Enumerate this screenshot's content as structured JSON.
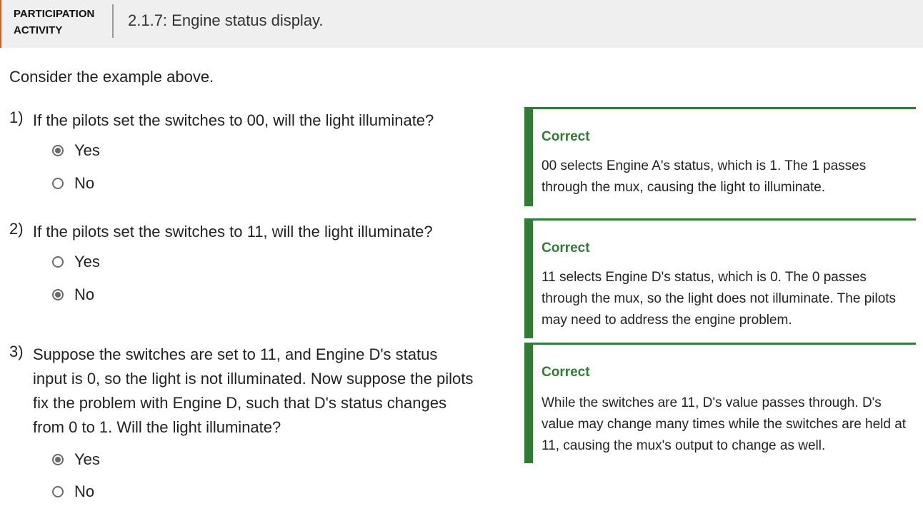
{
  "header": {
    "activity_label": "PARTICIPATION\nACTIVITY",
    "title": "2.1.7: Engine status display."
  },
  "intro": "Consider the example above.",
  "questions": [
    {
      "number": "1)",
      "text": "If the pilots set the switches to 00, will the light illuminate?",
      "options": [
        {
          "label": "Yes",
          "selected": true
        },
        {
          "label": "No",
          "selected": false
        }
      ],
      "feedback": {
        "status": "Correct",
        "text": "00 selects Engine A's status, which is 1. The 1 passes through the mux, causing the light to illuminate."
      }
    },
    {
      "number": "2)",
      "text": "If the pilots set the switches to 11, will the light illuminate?",
      "options": [
        {
          "label": "Yes",
          "selected": false
        },
        {
          "label": "No",
          "selected": true
        }
      ],
      "feedback": {
        "status": "Correct",
        "text": "11 selects Engine D's status, which is 0. The 0 passes through the mux, so the light does not illuminate. The pilots may need to address the engine problem."
      }
    },
    {
      "number": "3)",
      "text": "Suppose the switches are set to 11, and Engine D's status input is 0, so the light is not illuminated. Now suppose the pilots fix the problem with Engine D, such that D's status changes from 0 to 1. Will the light illuminate?",
      "options": [
        {
          "label": "Yes",
          "selected": true
        },
        {
          "label": "No",
          "selected": false
        }
      ],
      "feedback": {
        "status": "Correct",
        "text": "While the switches are 11, D's value passes through. D's value may change many times while the switches are held at 11, causing the mux's output to change as well."
      }
    }
  ],
  "colors": {
    "accent_orange": "#c8622a",
    "correct_green": "#2e7d32",
    "header_bg": "#efefef"
  }
}
